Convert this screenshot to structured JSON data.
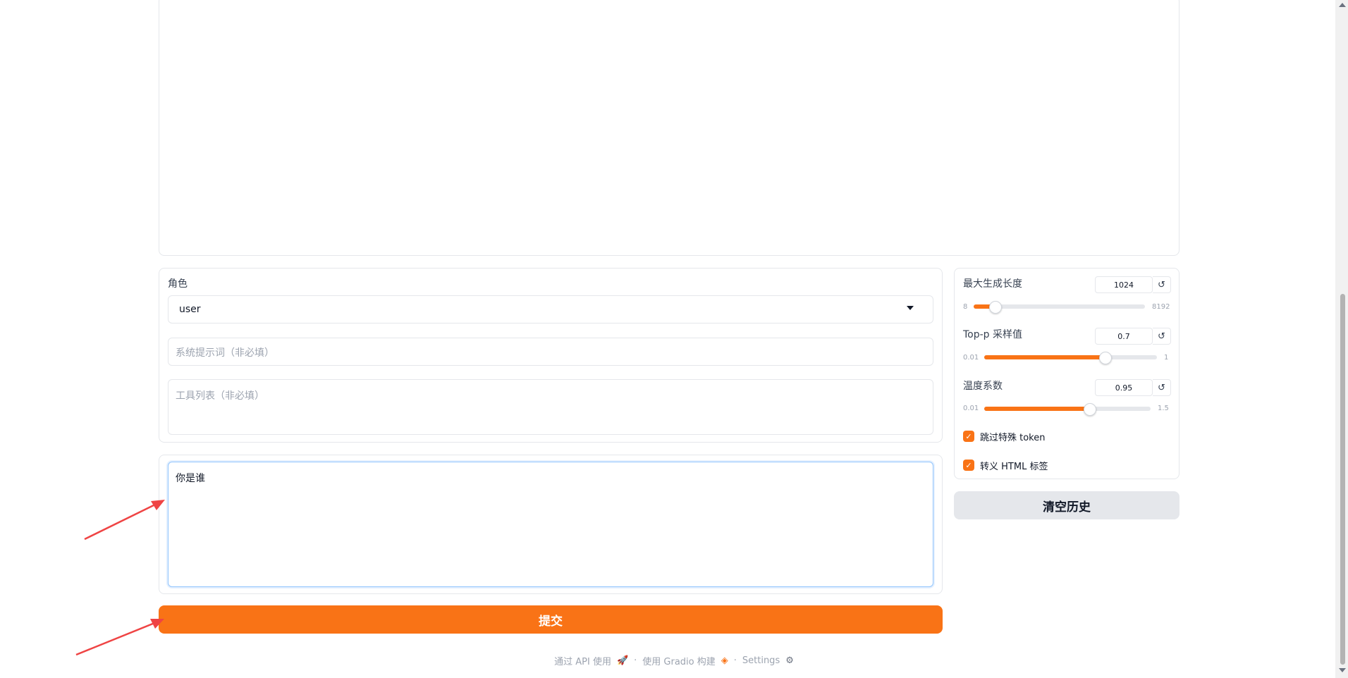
{
  "config": {
    "role_label": "角色",
    "role_value": "user",
    "system_prompt_placeholder": "系统提示词（非必填）",
    "tools_placeholder": "工具列表（非必填）"
  },
  "message": {
    "value": "你是谁"
  },
  "submit_label": "提交",
  "params": {
    "max_length": {
      "label": "最大生成长度",
      "value": "1024",
      "min": "8",
      "max": "8192",
      "fraction": 0.125
    },
    "top_p": {
      "label": "Top-p 采样值",
      "value": "0.7",
      "min": "0.01",
      "max": "1",
      "fraction": 0.697
    },
    "temperature": {
      "label": "温度系数",
      "value": "0.95",
      "min": "0.01",
      "max": "1.5",
      "fraction": 0.631
    },
    "reset_symbol": "↺"
  },
  "checkboxes": {
    "skip_special_tokens": {
      "label": "跳过特殊 token",
      "checked": true
    },
    "escape_html": {
      "label": "转义 HTML 标签",
      "checked": true
    }
  },
  "clear_label": "清空历史",
  "footer": {
    "api_text": "通过 API 使用",
    "separator": "·",
    "gradio_text": "使用 Gradio 构建",
    "settings_text": "Settings"
  },
  "colors": {
    "accent": "#f97316",
    "focus_border": "#93c5fd",
    "annotation_arrow": "#ef4444"
  }
}
